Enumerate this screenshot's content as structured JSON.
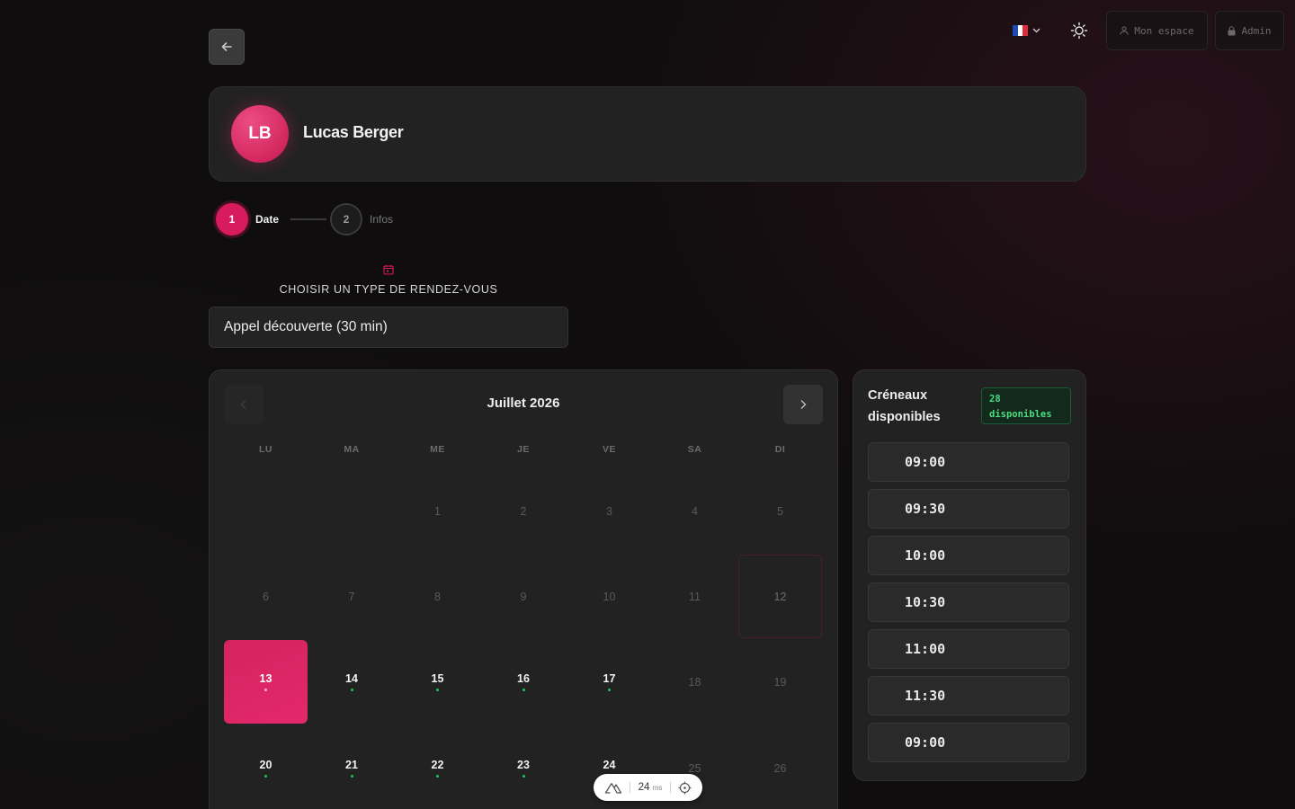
{
  "header": {
    "language_flag_colors": [
      "#1f4bb5",
      "#ffffff",
      "#e02b3a"
    ],
    "mon_espace_label": "Mon espace",
    "admin_label": "Admin"
  },
  "profile": {
    "initials": "LB",
    "name": "Lucas Berger"
  },
  "stepper": {
    "steps": [
      {
        "number": "1",
        "label": "Date",
        "active": true
      },
      {
        "number": "2",
        "label": "Infos",
        "active": false
      }
    ]
  },
  "appointment_type": {
    "heading": "CHOISIR UN TYPE DE RENDEZ-VOUS",
    "selected": "Appel découverte (30 min)"
  },
  "calendar": {
    "month_title": "Juillet 2026",
    "weekdays": [
      "LU",
      "MA",
      "ME",
      "JE",
      "VE",
      "SA",
      "DI"
    ],
    "weeks": [
      [
        "",
        "",
        "1",
        "2",
        "3",
        "4",
        "5"
      ],
      [
        "6",
        "7",
        "8",
        "9",
        "10",
        "11",
        "12"
      ],
      [
        "13",
        "14",
        "15",
        "16",
        "17",
        "18",
        "19"
      ],
      [
        "20",
        "21",
        "22",
        "23",
        "24",
        "25",
        "26"
      ]
    ],
    "today": "12",
    "selected": "13",
    "available_days": [
      "13",
      "14",
      "15",
      "16",
      "17",
      "20",
      "21",
      "22",
      "23",
      "24"
    ]
  },
  "slots": {
    "title": "Créneaux disponibles",
    "badge": "28 disponibles",
    "times": [
      "09:00",
      "09:30",
      "10:00",
      "10:30",
      "11:00",
      "11:30",
      "09:00"
    ]
  },
  "devtools": {
    "timing_value": "24",
    "timing_unit": "ms"
  },
  "colors": {
    "accent": "#d81b5d",
    "available_dot": "#22c55e",
    "background": "#0f0d0e",
    "card": "#222222"
  }
}
